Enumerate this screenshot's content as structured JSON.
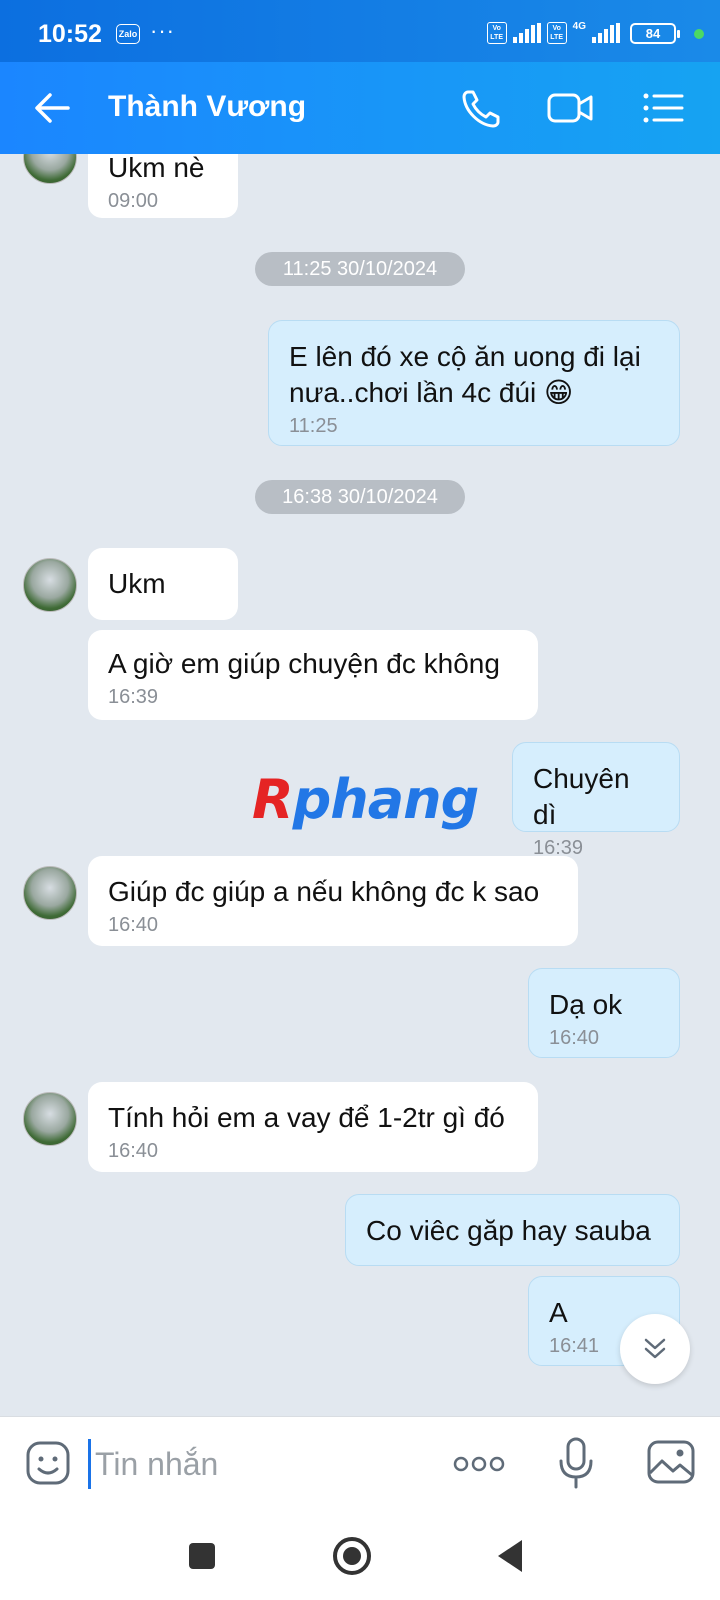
{
  "status_bar": {
    "time": "10:52",
    "app_badge": "Zalo",
    "more": "···",
    "volte_1": "Vo LTE",
    "volte_2": "Vo LTE",
    "network": "4G",
    "battery": "84"
  },
  "header": {
    "title": "Thành Vương",
    "icons": [
      "back-arrow-icon",
      "phone-icon",
      "video-camera-icon",
      "menu-list-icon"
    ]
  },
  "messages": [
    {
      "side": "in",
      "text": "Ukm nè",
      "time": "09:00"
    },
    {
      "type": "date",
      "label": "11:25 30/10/2024"
    },
    {
      "side": "out",
      "text": "E lên đó xe cộ ăn uong đi lại nưa..chơi lần 4c đúi 😁",
      "time": "11:25"
    },
    {
      "type": "date",
      "label": "16:38 30/10/2024"
    },
    {
      "side": "in",
      "text": "Ukm",
      "time": ""
    },
    {
      "side": "in",
      "text": "A giờ em giúp chuyện đc không",
      "time": "16:39"
    },
    {
      "side": "out",
      "text": "Chuyên dì",
      "time": "16:39"
    },
    {
      "side": "in",
      "text": "Giúp đc giúp a nếu không đc k sao",
      "time": "16:40"
    },
    {
      "side": "out",
      "text": "Dạ ok",
      "time": "16:40"
    },
    {
      "side": "in",
      "text": "Tính hỏi em a vay để 1-2tr gì đó",
      "time": "16:40"
    },
    {
      "side": "out",
      "text": "Co viêc găp hay sauba",
      "time": ""
    },
    {
      "side": "out",
      "text": "A",
      "time": "16:41"
    }
  ],
  "watermark": {
    "first": "R",
    "rest": "phang"
  },
  "input": {
    "placeholder": "Tin nhắn"
  },
  "colors": {
    "header_start": "#1b86ff",
    "header_end": "#16a3f2",
    "out_bubble": "#d6eefd",
    "in_bubble": "#ffffff",
    "chat_bg": "#e2e8ef"
  }
}
